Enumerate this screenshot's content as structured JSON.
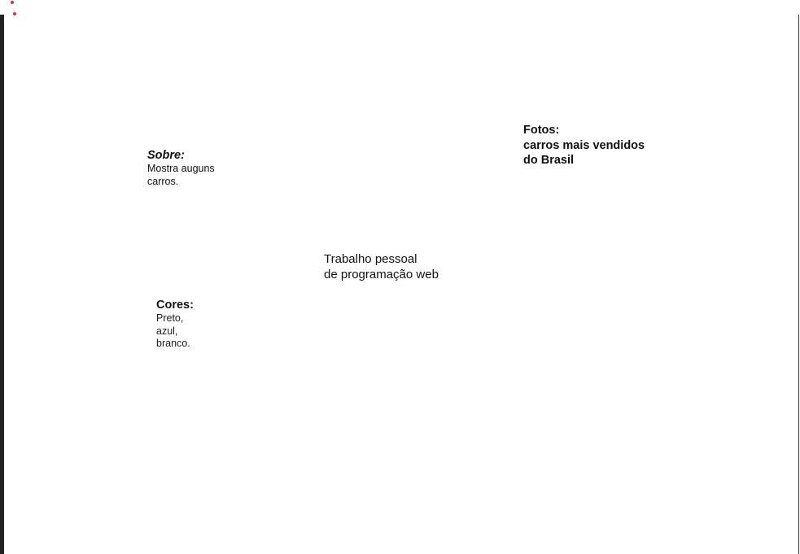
{
  "sobre": {
    "heading": "Sobre:",
    "lines": [
      "Mostra auguns",
      "carros."
    ]
  },
  "fotos": {
    "lines": [
      "Fotos:",
      "carros mais vendidos",
      "do Brasil"
    ]
  },
  "trabalho": {
    "lines": [
      "Trabalho pessoal",
      "de programação web"
    ]
  },
  "cores": {
    "heading": "Cores:",
    "lines": [
      "Preto,",
      "azul,",
      "branco."
    ]
  },
  "colors": {
    "accent_dots": "#e0313a",
    "left_bar": "#222222",
    "background": "#ffffff"
  }
}
